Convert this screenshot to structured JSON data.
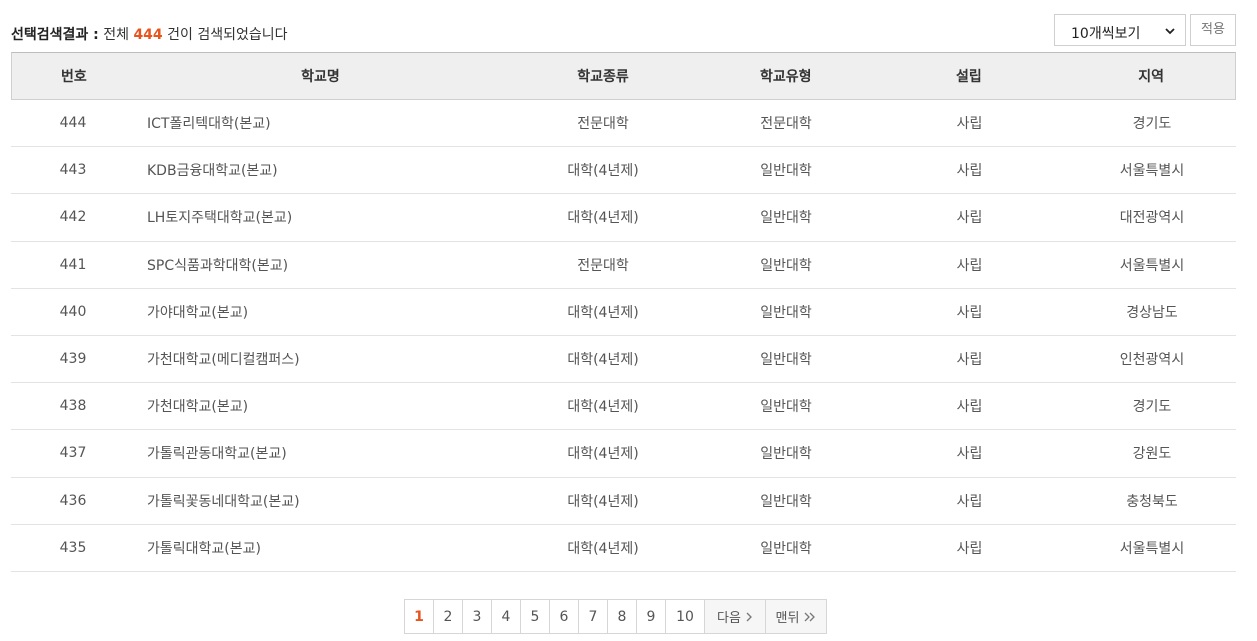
{
  "result": {
    "label": "선택검색결과 :",
    "prefix": "전체",
    "count": "444",
    "suffix": "건이 검색되었습니다"
  },
  "per_page": {
    "selected": "10개씩보기"
  },
  "apply_label": "적용",
  "columns": [
    "번호",
    "학교명",
    "학교종류",
    "학교유형",
    "설립",
    "지역"
  ],
  "rows": [
    {
      "no": "444",
      "name": "ICT폴리텍대학(본교)",
      "kind": "전문대학",
      "type": "전문대학",
      "est": "사립",
      "region": "경기도"
    },
    {
      "no": "443",
      "name": "KDB금융대학교(본교)",
      "kind": "대학(4년제)",
      "type": "일반대학",
      "est": "사립",
      "region": "서울특별시"
    },
    {
      "no": "442",
      "name": "LH토지주택대학교(본교)",
      "kind": "대학(4년제)",
      "type": "일반대학",
      "est": "사립",
      "region": "대전광역시"
    },
    {
      "no": "441",
      "name": "SPC식품과학대학(본교)",
      "kind": "전문대학",
      "type": "일반대학",
      "est": "사립",
      "region": "서울특별시"
    },
    {
      "no": "440",
      "name": "가야대학교(본교)",
      "kind": "대학(4년제)",
      "type": "일반대학",
      "est": "사립",
      "region": "경상남도"
    },
    {
      "no": "439",
      "name": "가천대학교(메디컬캠퍼스)",
      "kind": "대학(4년제)",
      "type": "일반대학",
      "est": "사립",
      "region": "인천광역시"
    },
    {
      "no": "438",
      "name": "가천대학교(본교)",
      "kind": "대학(4년제)",
      "type": "일반대학",
      "est": "사립",
      "region": "경기도"
    },
    {
      "no": "437",
      "name": "가톨릭관동대학교(본교)",
      "kind": "대학(4년제)",
      "type": "일반대학",
      "est": "사립",
      "region": "강원도"
    },
    {
      "no": "436",
      "name": "가톨릭꽃동네대학교(본교)",
      "kind": "대학(4년제)",
      "type": "일반대학",
      "est": "사립",
      "region": "충청북도"
    },
    {
      "no": "435",
      "name": "가톨릭대학교(본교)",
      "kind": "대학(4년제)",
      "type": "일반대학",
      "est": "사립",
      "region": "서울특별시"
    }
  ],
  "pagination": {
    "pages": [
      "1",
      "2",
      "3",
      "4",
      "5",
      "6",
      "7",
      "8",
      "9",
      "10"
    ],
    "current": "1",
    "next_label": "다음",
    "last_label": "맨뒤"
  },
  "colors": {
    "accent": "#e8541e",
    "header_bg": "#efefef"
  },
  "icons": {
    "per_page_caret": "chevron-down-icon",
    "next": "chevron-right-icon",
    "last": "double-chevron-right-icon"
  }
}
